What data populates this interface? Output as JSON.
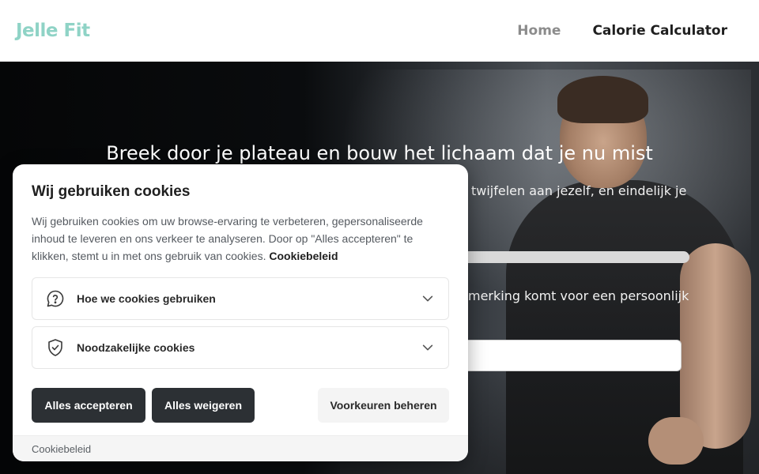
{
  "header": {
    "brand": "Jelle Fit",
    "nav": [
      {
        "label": "Home"
      },
      {
        "label": "Calorie Calculator"
      }
    ]
  },
  "hero": {
    "title": "Breek door je plateau en bouw het lichaam dat je nu mist",
    "subtitle_visible": "twijfelen aan jezelf, en eindelijk je",
    "line2_visible": "merking komt voor een persoonlijk"
  },
  "cookie": {
    "title": "Wij gebruiken cookies",
    "text": "Wij gebruiken cookies om uw browse-ervaring te verbeteren, gepersonaliseerde inhoud te leveren en ons verkeer te analyseren. Door op \"Alles accepteren\" te klikken, stemt u in met ons gebruik van cookies.",
    "policy_link": "Cookiebeleid",
    "sections": [
      {
        "label": "Hoe we cookies gebruiken",
        "icon": "question-bubble-icon"
      },
      {
        "label": "Noodzakelijke cookies",
        "icon": "shield-check-icon"
      }
    ],
    "buttons": {
      "accept_all": "Alles accepteren",
      "reject_all": "Alles weigeren",
      "manage": "Voorkeuren beheren"
    },
    "footer_link": "Cookiebeleid"
  },
  "colors": {
    "brand": "#8fd3c6",
    "button_dark": "#2c3034"
  }
}
